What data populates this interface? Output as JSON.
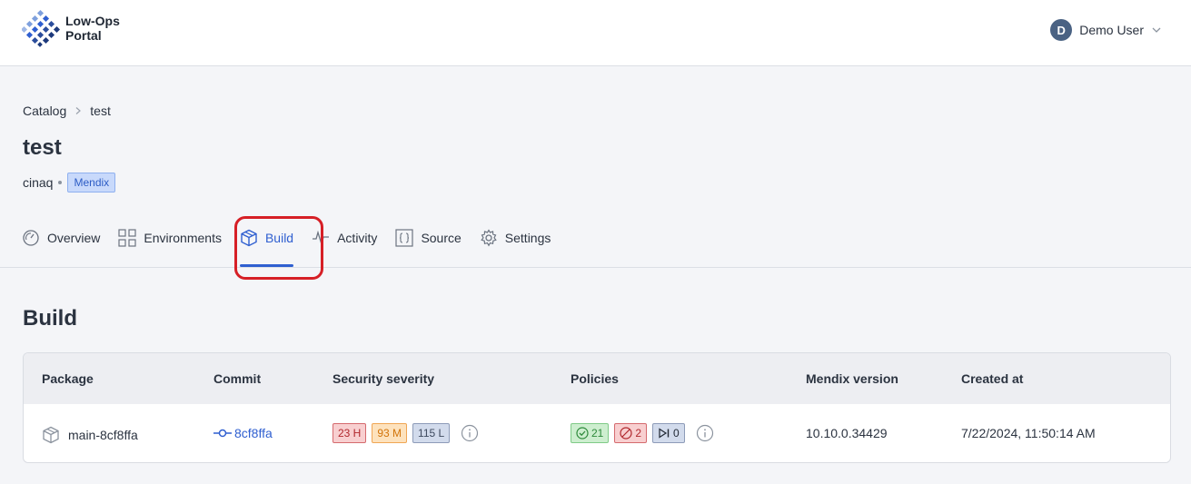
{
  "brand": {
    "line1": "Low-Ops",
    "line2": "Portal"
  },
  "user": {
    "initial": "D",
    "name": "Demo User"
  },
  "breadcrumb": {
    "root": "Catalog",
    "separator": ">",
    "current": "test"
  },
  "app": {
    "title": "test",
    "owner": "cinaq",
    "tech_tag": "Mendix"
  },
  "tabs": [
    {
      "label": "Overview",
      "icon": "dashboard-icon"
    },
    {
      "label": "Environments",
      "icon": "grid-icon"
    },
    {
      "label": "Build",
      "icon": "cube-icon",
      "active": true
    },
    {
      "label": "Activity",
      "icon": "activity-icon"
    },
    {
      "label": "Source",
      "icon": "braces-icon"
    },
    {
      "label": "Settings",
      "icon": "gear-icon"
    }
  ],
  "section": {
    "title": "Build"
  },
  "table": {
    "headers": [
      "Package",
      "Commit",
      "Security severity",
      "Policies",
      "Mendix version",
      "Created at"
    ],
    "rows": [
      {
        "package": "main-8cf8ffa",
        "commit": "8cf8ffa",
        "severity": {
          "high": "23 H",
          "medium": "93 M",
          "low": "115 L"
        },
        "policies": {
          "passed": "21",
          "failed": "2",
          "skipped": "0"
        },
        "mendix_version": "10.10.0.34429",
        "created_at": "7/22/2024, 11:50:14 AM"
      }
    ]
  },
  "colors": {
    "accent": "#2f5fd0",
    "highlight": "#d61f26"
  }
}
